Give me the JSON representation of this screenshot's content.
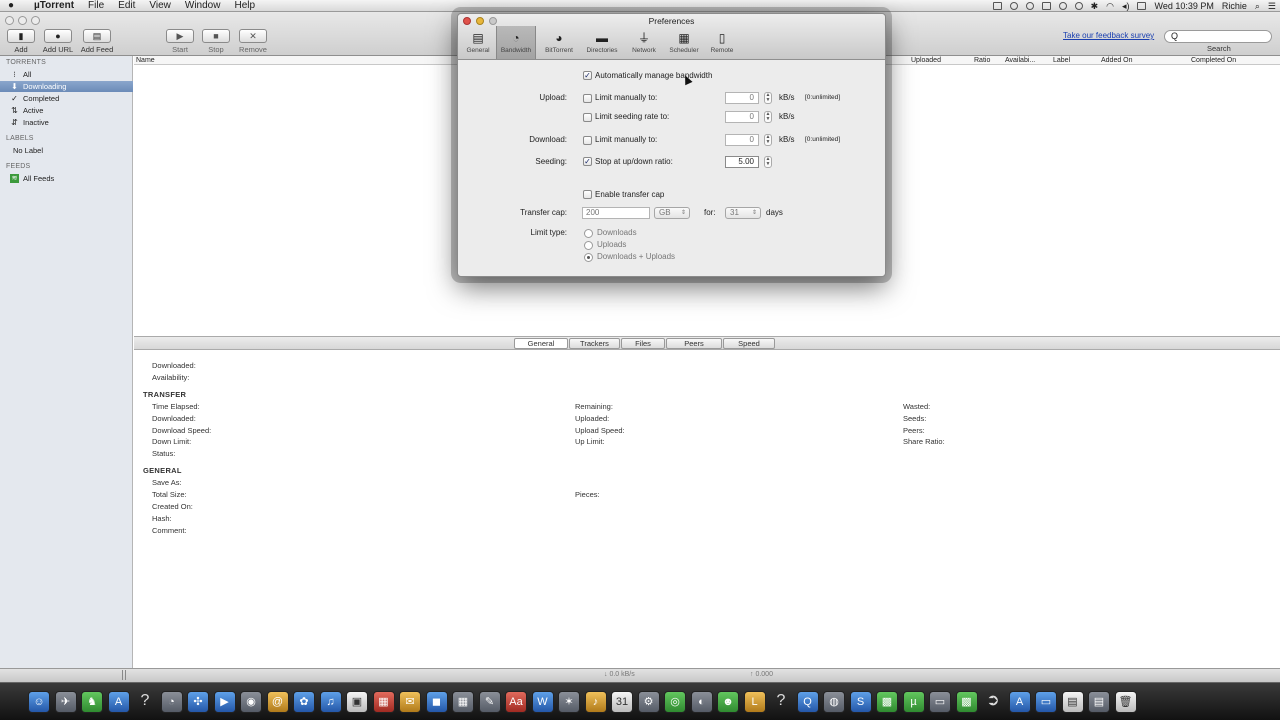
{
  "menubar": {
    "app": "µTorrent",
    "items": [
      "File",
      "Edit",
      "View",
      "Window",
      "Help"
    ],
    "clock": "Wed 10:39 PM",
    "user": "Richie"
  },
  "toolbar": {
    "add": "Add",
    "add_url": "Add URL",
    "add_feed": "Add Feed",
    "start": "Start",
    "stop": "Stop",
    "remove": "Remove",
    "survey": "Take our feedback survey",
    "search_label": "Search",
    "search_placeholder": "Q"
  },
  "sidebar": {
    "torrents_header": "TORRENTS",
    "items": [
      "All",
      "Downloading",
      "Completed",
      "Active",
      "Inactive"
    ],
    "labels_header": "LABELS",
    "no_label": "No Label",
    "feeds_header": "FEEDS",
    "all_feeds": "All Feeds"
  },
  "list": {
    "columns": [
      "Name",
      "Uploaded",
      "Ratio",
      "Availabi...",
      "Label",
      "Added On",
      "Completed On"
    ]
  },
  "details": {
    "tabs": [
      "General",
      "Trackers",
      "Files",
      "Peers",
      "Speed"
    ],
    "active_tab": "General",
    "top": [
      "Downloaded:",
      "Availability:"
    ],
    "transfer_header": "TRANSFER",
    "transfer_col1": [
      "Time Elapsed:",
      "Downloaded:",
      "Download Speed:",
      "Down Limit:",
      "Status:"
    ],
    "transfer_col2": [
      "Remaining:",
      "Uploaded:",
      "Upload Speed:",
      "Up Limit:"
    ],
    "transfer_col3": [
      "Wasted:",
      "Seeds:",
      "Peers:",
      "Share Ratio:"
    ],
    "general_header": "GENERAL",
    "general_col1": [
      "Save As:",
      "Total Size:",
      "Created On:",
      "Hash:",
      "Comment:"
    ],
    "pieces": "Pieces:"
  },
  "statusbar": {
    "down": "↓ 0.0 kB/s",
    "up": "↑ 0.000"
  },
  "preferences": {
    "title": "Preferences",
    "tabs": [
      "General",
      "Bandwidth",
      "BitTorrent",
      "Directories",
      "Network",
      "Scheduler",
      "Remote"
    ],
    "active_tab": "Bandwidth",
    "auto_manage": "Automatically manage bandwidth",
    "upload_label": "Upload:",
    "limit_manually": "Limit manually to:",
    "limit_seeding": "Limit seeding rate to:",
    "download_label": "Download:",
    "seeding_label": "Seeding:",
    "stop_ratio": "Stop at up/down ratio:",
    "unit": "kB/s",
    "unlimited_hint": "[0:unlimited]",
    "upload_value": "0",
    "seeding_value": "0",
    "download_value": "0",
    "ratio_value": "5.00",
    "enable_cap": "Enable transfer cap",
    "transfer_cap_label": "Transfer cap:",
    "cap_value": "200",
    "cap_unit": "GB",
    "for_label": "for:",
    "days_value": "31",
    "days_label": "days",
    "limit_type_label": "Limit type:",
    "limit_types": [
      "Downloads",
      "Uploads",
      "Downloads + Uploads"
    ],
    "limit_type_selected": "Downloads + Uploads"
  },
  "dock": {
    "icons": [
      "finder-icon",
      "launchpad-icon",
      "chess-icon",
      "app-store-icon",
      "help-icon",
      "dashboard-icon",
      "safari-icon",
      "facetime-icon",
      "photo-booth-icon",
      "contacts-icon",
      "iphoto-icon",
      "itunes-icon",
      "photo-icon",
      "preview-icon",
      "mail-icon",
      "calculator-icon",
      "pencil-icon",
      "dictionary-icon",
      "word-icon",
      "star-icon",
      "guitar-icon",
      "calendar-icon",
      "settings-icon",
      "chrome-icon",
      "activity-icon",
      "monster-icon",
      "l-icon",
      "help2-icon",
      "quicktime-icon",
      "dvd-icon",
      "skype-icon",
      "minecraft-icon",
      "utorrent-icon",
      "keyboard-icon",
      "minecraft2-icon",
      "arrow-icon",
      "apps-folder-icon",
      "docs-folder-icon",
      "downloads-folder-icon",
      "desktop-icon",
      "trash-icon"
    ]
  }
}
